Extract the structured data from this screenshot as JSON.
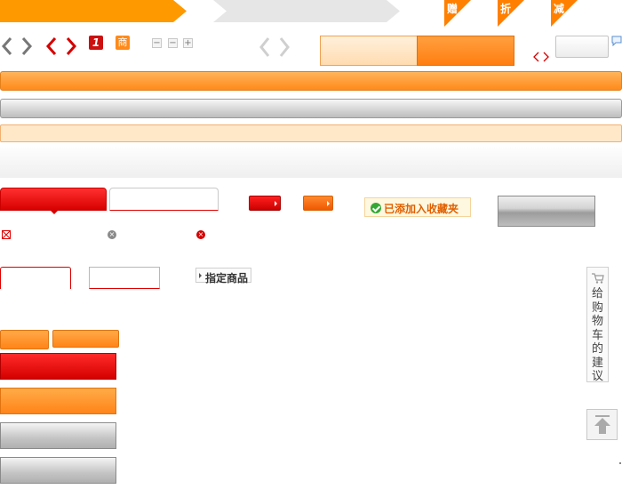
{
  "tags": {
    "gift": "赠",
    "discount": "折",
    "reduce": "减"
  },
  "icons": {
    "arrow_gray": "chevron-gray-icon",
    "arrow_red": "chevron-red-icon",
    "badge_one": "1",
    "badge_shop": "商",
    "stepper_minus": "−",
    "stepper_plus": "+",
    "close_glyph": "×"
  },
  "notice": {
    "favorite_added": "已添加入收藏夹"
  },
  "spec": {
    "label": "指定商品"
  },
  "feedback": {
    "label": "给购物车的建议"
  },
  "colors": {
    "orange": "#ff8a1a",
    "red": "#d80000",
    "gray": "#bdbdbd",
    "light_orange": "#ffe8c8",
    "success_green": "#34a834"
  }
}
